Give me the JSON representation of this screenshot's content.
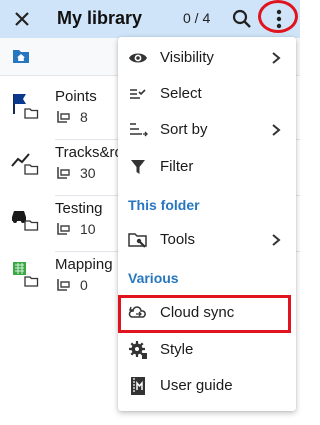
{
  "appbar": {
    "title": "My library",
    "counter": "0 / 4",
    "icons": [
      "close-icon",
      "search-icon",
      "more-vert-icon"
    ]
  },
  "location": {
    "icon": "home-folder-icon"
  },
  "list": [
    {
      "name": "Points",
      "count": "8",
      "icon": "flag-folder-icon"
    },
    {
      "name": "Tracks&ro",
      "count": "30",
      "icon": "track-folder-icon"
    },
    {
      "name": "Testing",
      "count": "10",
      "icon": "car-folder-icon"
    },
    {
      "name": "Mapping",
      "count": "0",
      "icon": "map-folder-icon"
    }
  ],
  "menu": {
    "visibility": "Visibility",
    "select": "Select",
    "sort_by": "Sort by",
    "filter": "Filter",
    "section_folder": "This folder",
    "tools": "Tools",
    "section_various": "Various",
    "cloud_sync": "Cloud sync",
    "style": "Style",
    "user_guide": "User guide"
  },
  "colors": {
    "appbar": "#cfe4f8",
    "accent": "#2777c0",
    "highlight": "#e0141e"
  }
}
